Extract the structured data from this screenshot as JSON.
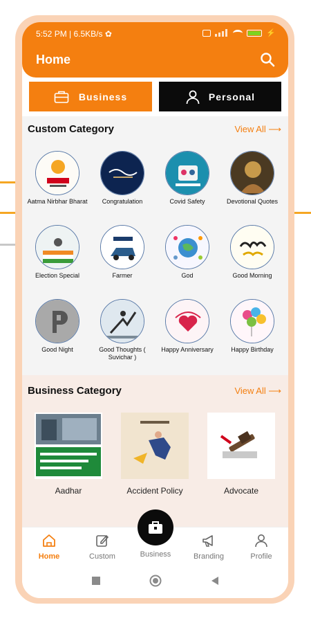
{
  "status_bar": {
    "time": "5:52 PM | 6.5KB/s ✿"
  },
  "header": {
    "title": "Home"
  },
  "mode_tabs": {
    "business": "Business",
    "personal": "Personal"
  },
  "custom_category": {
    "title": "Custom Category",
    "view_all": "View All ⟶",
    "items": [
      {
        "label": "Aatma Nirbhar Bharat"
      },
      {
        "label": "Congratulation"
      },
      {
        "label": "Covid Safety"
      },
      {
        "label": "Devotional Quotes"
      },
      {
        "label": "Election Special"
      },
      {
        "label": "Farmer"
      },
      {
        "label": "God"
      },
      {
        "label": "Good Morning"
      },
      {
        "label": "Good Night"
      },
      {
        "label": "Good Thoughts ( Suvichar )"
      },
      {
        "label": "Happy Anniversary"
      },
      {
        "label": "Happy Birthday"
      }
    ]
  },
  "business_category": {
    "title": "Business Category",
    "view_all": "View All ⟶",
    "items": [
      {
        "label": "Aadhar"
      },
      {
        "label": "Accident Policy"
      },
      {
        "label": "Advocate"
      }
    ]
  },
  "bottom_nav": {
    "home": "Home",
    "custom": "Custom",
    "business": "Business",
    "branding": "Branding",
    "profile": "Profile"
  },
  "colors": {
    "accent": "#f47f10",
    "dark": "#0b0b0b"
  }
}
